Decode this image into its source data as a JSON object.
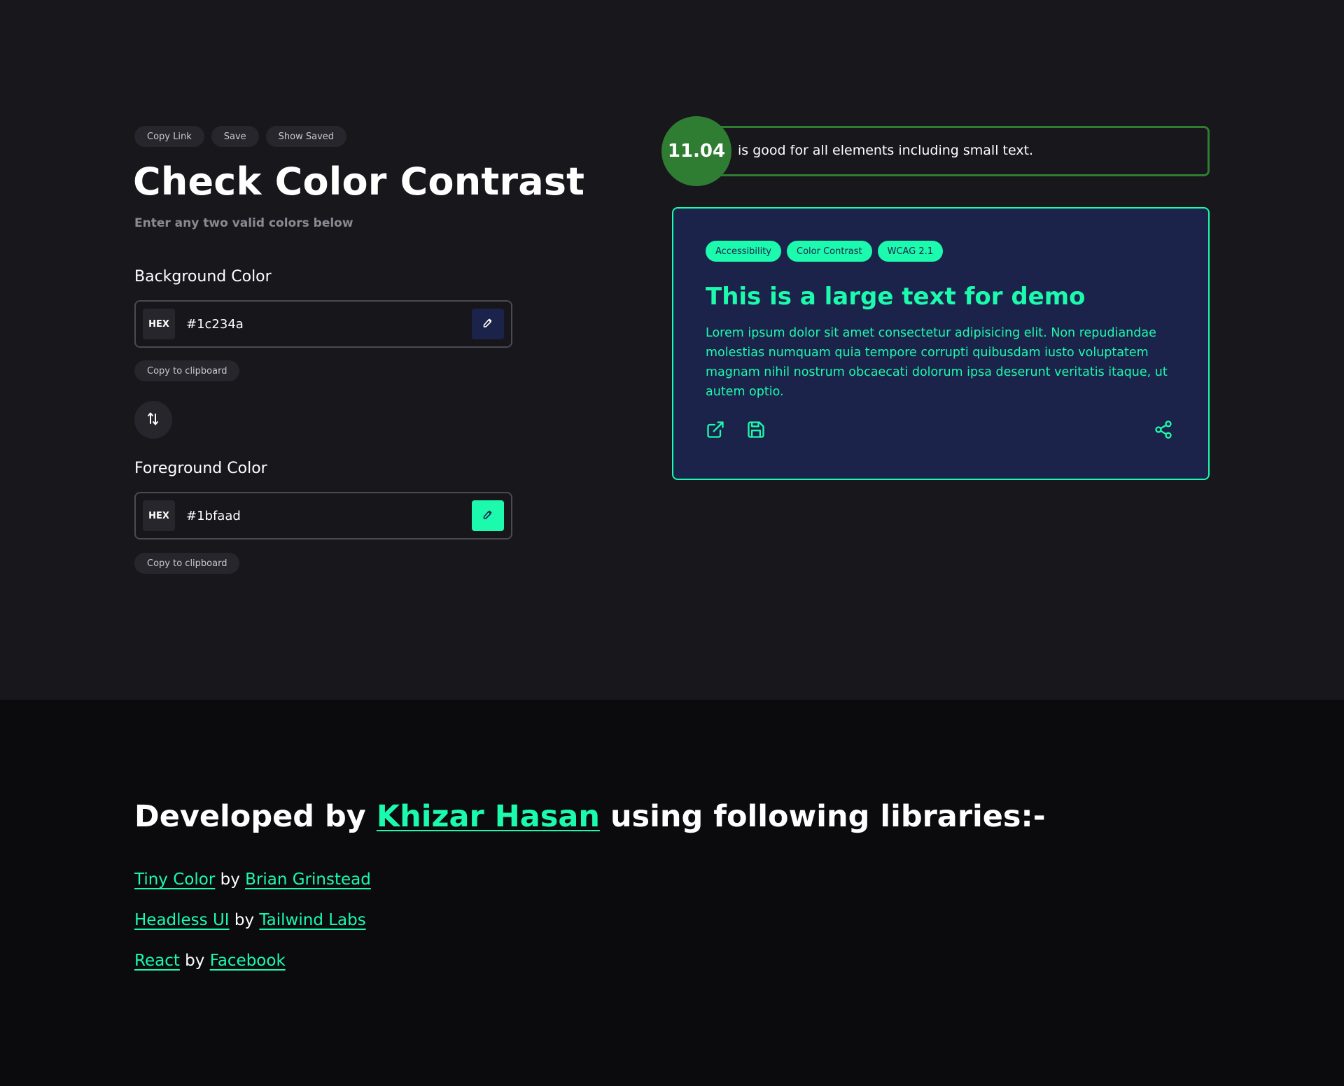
{
  "colors": {
    "background": "#1c234a",
    "foreground": "#1bfaad",
    "status_good": "#2e7d32",
    "page_background": "#17171c",
    "footer_background": "#0b0b0e"
  },
  "toolbar": {
    "copy_link_label": "Copy Link",
    "save_label": "Save",
    "show_saved_label": "Show Saved"
  },
  "header": {
    "title": "Check Color Contrast",
    "subtitle": "Enter any two valid colors below"
  },
  "background_field": {
    "label": "Background Color",
    "format": "HEX",
    "value": "#1c234a",
    "copy_label": "Copy to clipboard"
  },
  "foreground_field": {
    "label": "Foreground Color",
    "format": "HEX",
    "value": "#1bfaad",
    "copy_label": "Copy to clipboard"
  },
  "icons": {
    "swap": "swap-icon",
    "picker": "eyedropper-icon",
    "open": "external-link-icon",
    "save": "floppy-disk-icon",
    "share": "share-icon"
  },
  "result": {
    "ratio": "11.04",
    "message": "is good for all elements including small text."
  },
  "preview": {
    "tags": [
      "Accessibility",
      "Color Contrast",
      "WCAG 2.1"
    ],
    "heading": "This is a large text for demo",
    "body": "Lorem ipsum dolor sit amet consectetur adipisicing elit. Non repudiandae molestias numquam quia tempore corrupti quibusdam iusto voluptatem magnam nihil nostrum obcaecati dolorum ipsa deserunt veritatis itaque, ut autem optio."
  },
  "credits": {
    "prefix": "Developed by",
    "author": "Khizar Hasan",
    "suffix": "using following libraries:-",
    "by_word": "by",
    "libraries": [
      {
        "name": "Tiny Color",
        "author": "Brian Grinstead"
      },
      {
        "name": "Headless UI",
        "author": "Tailwind Labs"
      },
      {
        "name": "React",
        "author": "Facebook"
      }
    ]
  }
}
